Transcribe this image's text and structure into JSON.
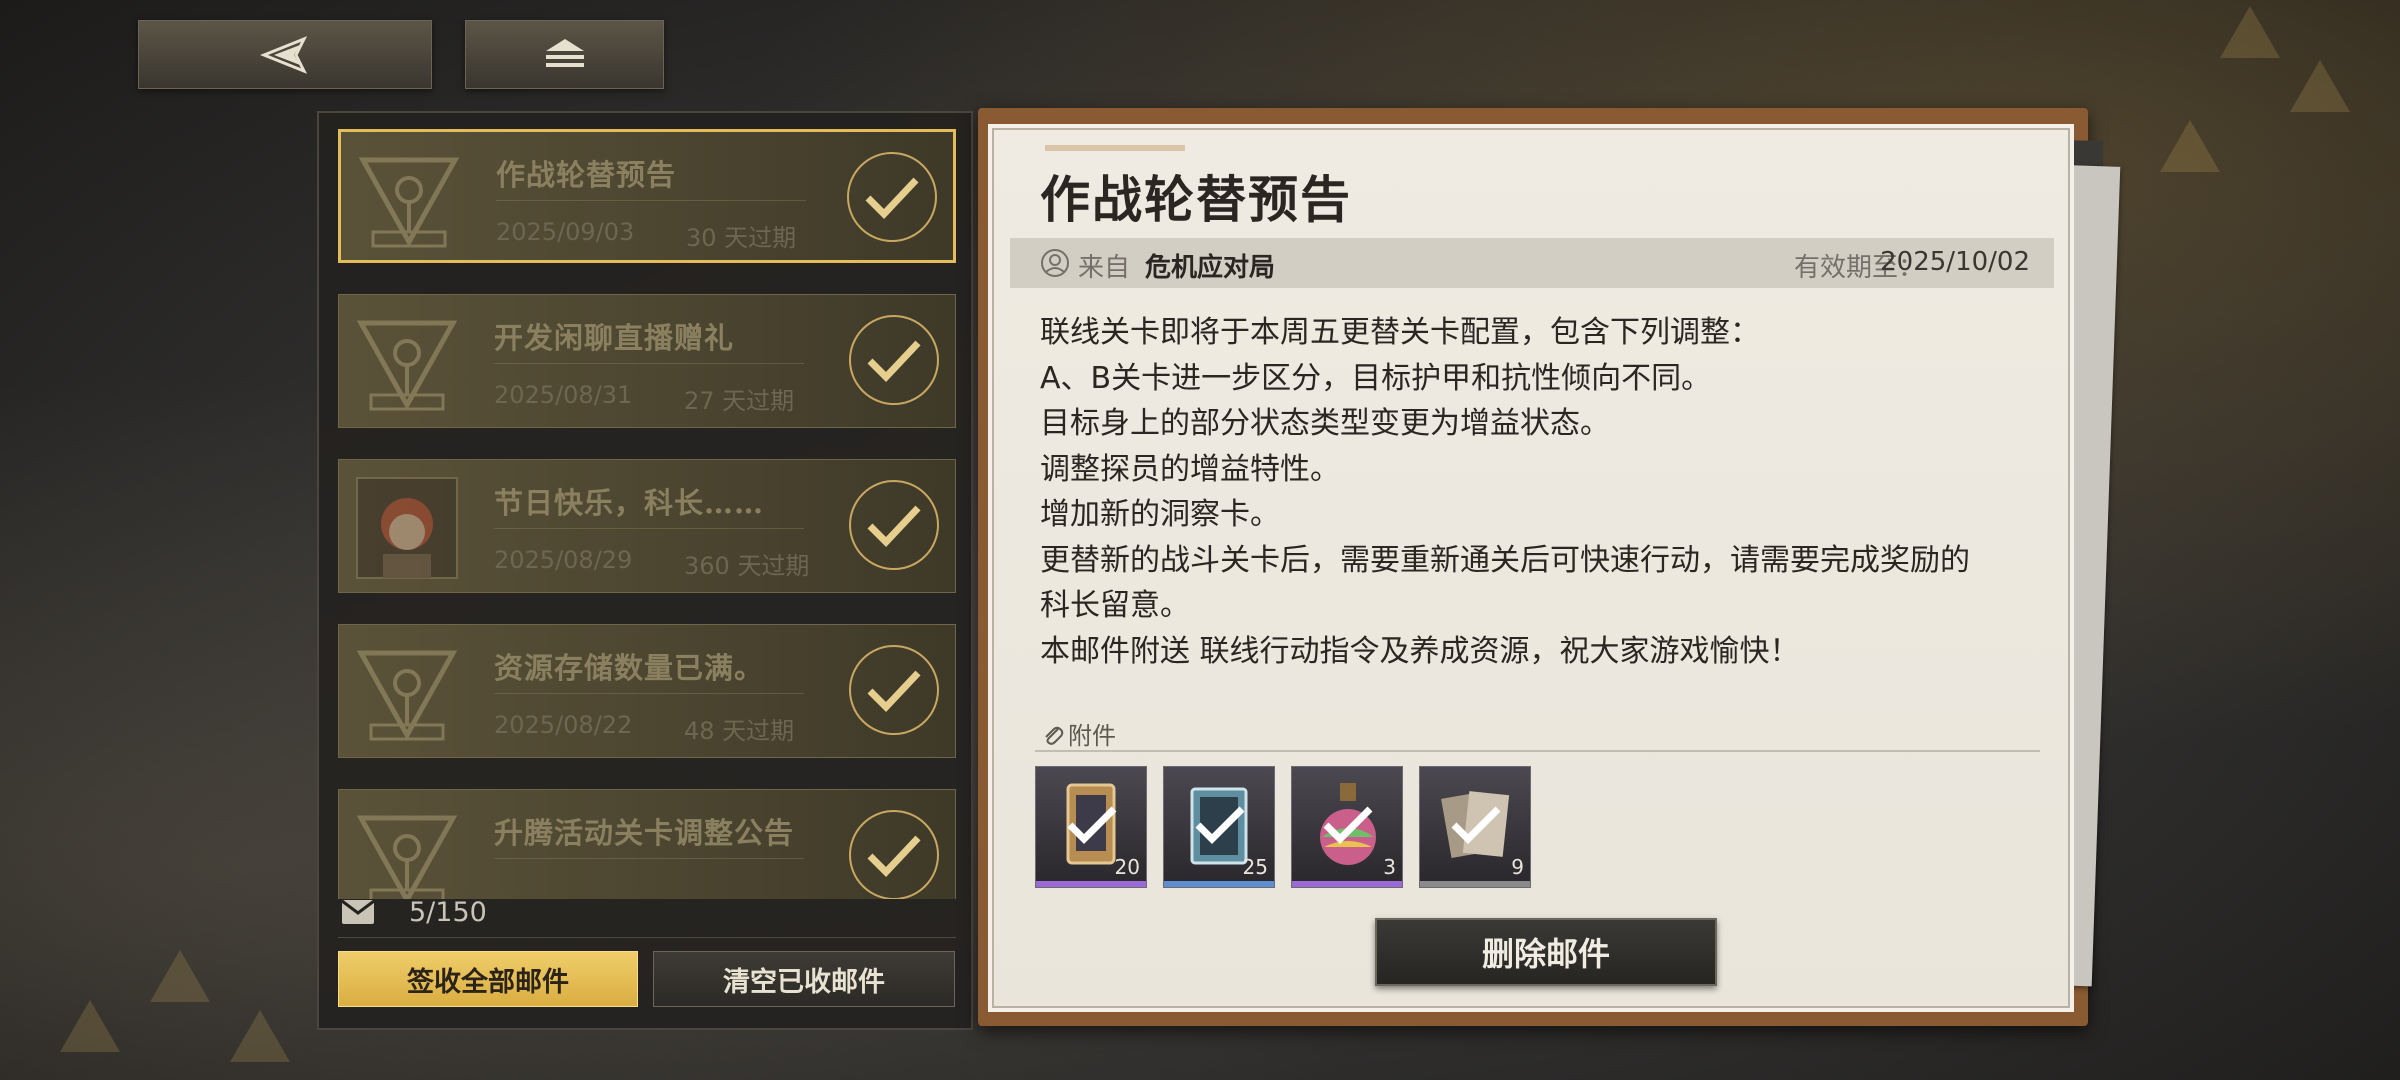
{
  "nav": {
    "back_icon": "back-arrow-icon",
    "home_icon": "home-stack-icon"
  },
  "mail_list": {
    "items": [
      {
        "title": "作战轮替预告",
        "date": "2025/09/03",
        "expire": "30 天过期",
        "selected": true,
        "icon": "emblem-icon"
      },
      {
        "title": "开发闲聊直播赠礼",
        "date": "2025/08/31",
        "expire": "27 天过期",
        "selected": false,
        "icon": "emblem-icon"
      },
      {
        "title": "节日快乐，科长……",
        "date": "2025/08/29",
        "expire": "360 天过期",
        "selected": false,
        "icon": "character-portrait"
      },
      {
        "title": "资源存储数量已满。",
        "date": "2025/08/22",
        "expire": "48 天过期",
        "selected": false,
        "icon": "emblem-icon"
      },
      {
        "title": "升腾活动关卡调整公告",
        "date": "",
        "expire": "",
        "selected": false,
        "icon": "emblem-icon"
      }
    ],
    "count": "5/150",
    "claim_all_label": "签收全部邮件",
    "clear_claimed_label": "清空已收邮件"
  },
  "detail": {
    "title": "作战轮替预告",
    "sender_prefix": "来自",
    "sender_name": "危机应对局",
    "expiry_label": "有效期至：",
    "expiry_value": "2025/10/02",
    "body": [
      "联线关卡即将于本周五更替关卡配置，包含下列调整：",
      "A、B关卡进一步区分，目标护甲和抗性倾向不同。",
      "目标身上的部分状态类型变更为增益状态。",
      "调整探员的增益特性。",
      "增加新的洞察卡。",
      "更替新的战斗关卡后，需要重新通关后可快速行动，请需要完成奖励的",
      "科长留意。",
      "本邮件附送 联线行动指令及养成资源，祝大家游戏愉快！"
    ],
    "attachments_label": "附件",
    "attachments": [
      {
        "name": "card-item",
        "qty": "20",
        "stripe": "#9a6ad6"
      },
      {
        "name": "book-item",
        "qty": "25",
        "stripe": "#5d8fd0"
      },
      {
        "name": "potion-item",
        "qty": "3",
        "stripe": "#9a6ad6"
      },
      {
        "name": "pages-item",
        "qty": "9",
        "stripe": "#8a8a8a"
      }
    ],
    "delete_label": "删除邮件"
  },
  "colors": {
    "accent_gold": "#e3bd5c",
    "panel_dark": "#24221f",
    "paper": "#efebe2"
  }
}
